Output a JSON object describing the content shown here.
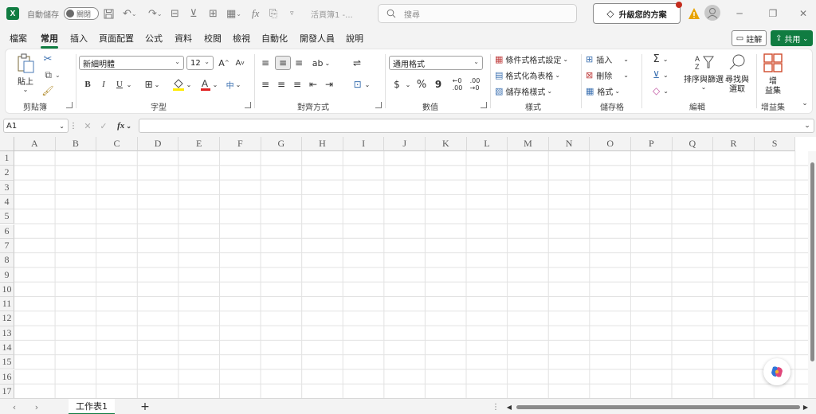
{
  "titlebar": {
    "app_logo": "X",
    "autosave_label": "自動儲存",
    "autosave_state": "關閉",
    "doc_title": "活頁簿1 -...",
    "search_placeholder": "搜尋",
    "upgrade_label": "升級您的方案"
  },
  "menu": {
    "tabs": [
      "檔案",
      "常用",
      "插入",
      "頁面配置",
      "公式",
      "資料",
      "校閱",
      "檢視",
      "自動化",
      "開發人員",
      "說明"
    ],
    "active": "常用",
    "comment_label": "註解",
    "share_label": "共用"
  },
  "ribbon": {
    "clipboard": {
      "paste_label": "貼上",
      "group": "剪貼簿"
    },
    "font": {
      "name": "新細明體",
      "size": "12",
      "bold": "B",
      "italic": "I",
      "underline": "U",
      "group": "字型"
    },
    "alignment": {
      "group": "對齊方式"
    },
    "number": {
      "format": "通用格式",
      "currency": "$",
      "percent": "%",
      "comma": "9",
      "group": "數值"
    },
    "styles": {
      "conditional": "條件式格式設定",
      "table": "格式化為表格",
      "cell_styles": "儲存格樣式",
      "group": "樣式"
    },
    "cells": {
      "insert": "插入",
      "delete": "刪除",
      "format": "格式",
      "group": "儲存格"
    },
    "editing": {
      "sort_filter": "排序與篩選",
      "find_select_1": "尋找與",
      "find_select_2": "選取",
      "group": "編輯"
    },
    "addins": {
      "label_1": "增",
      "label_2": "益集",
      "group": "增益集"
    }
  },
  "formula_bar": {
    "name_box": "A1",
    "fx": "fx"
  },
  "grid": {
    "columns": [
      "A",
      "B",
      "C",
      "D",
      "E",
      "F",
      "G",
      "H",
      "I",
      "J",
      "K",
      "L",
      "M",
      "N",
      "O",
      "P",
      "Q",
      "R",
      "S"
    ],
    "rows": [
      "1",
      "2",
      "3",
      "4",
      "5",
      "6",
      "7",
      "8",
      "9",
      "10",
      "11",
      "12",
      "13",
      "14",
      "15",
      "16",
      "17"
    ]
  },
  "sheets": {
    "tabs": [
      "工作表1"
    ],
    "add": "+"
  },
  "colors": {
    "accent": "#107c41",
    "warning": "#e8a300",
    "badge": "#c42b1c"
  }
}
